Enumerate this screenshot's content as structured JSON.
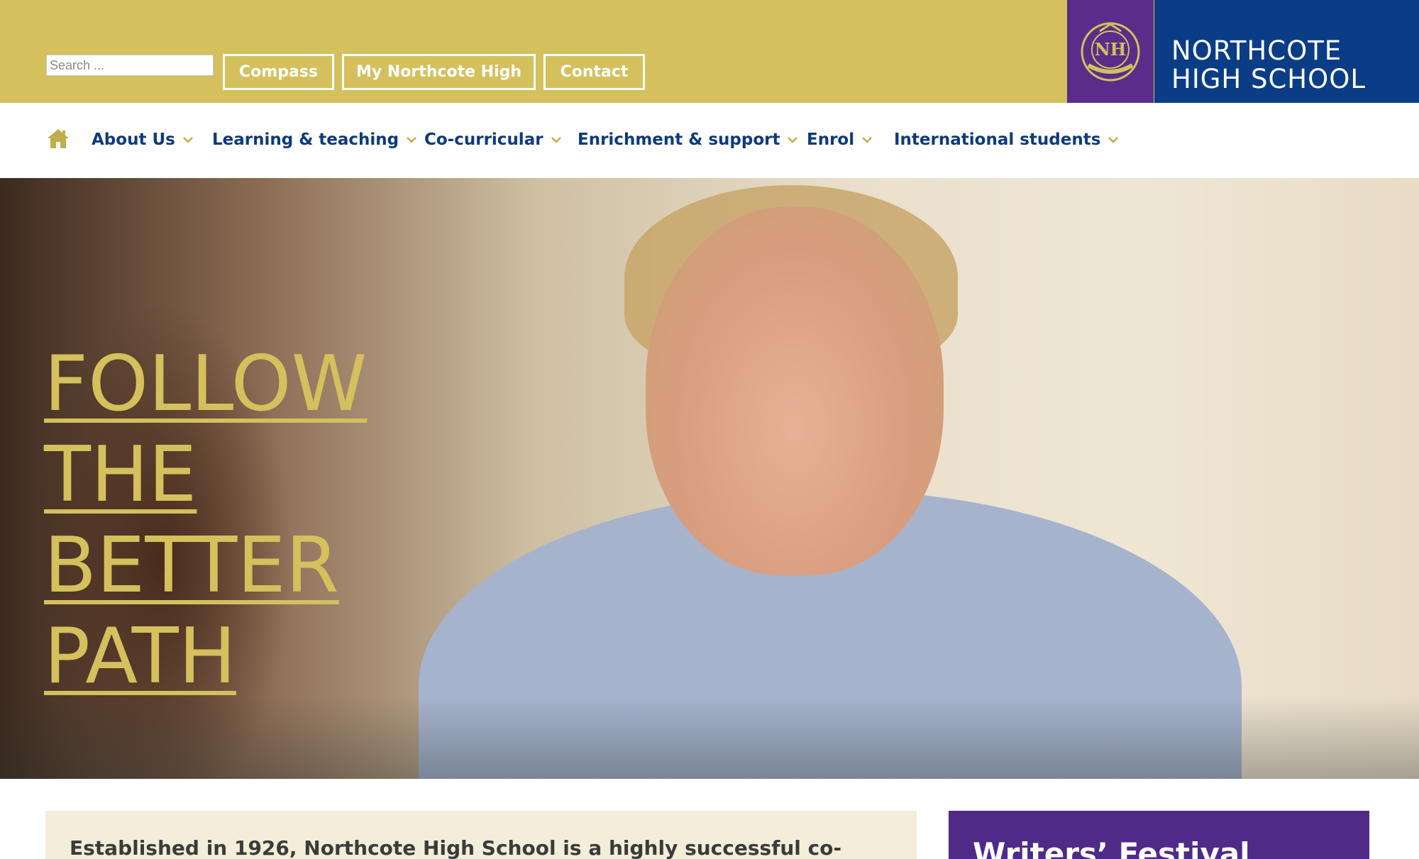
{
  "header": {
    "search": {
      "placeholder": "Search ...",
      "value": ""
    },
    "buttons": [
      "Compass",
      "My Northcote High",
      "Contact"
    ],
    "logo": {
      "line1": "NORTHCOTE",
      "line2": "HIGH SCHOOL",
      "crest_text": "NORTHCOTE"
    },
    "colors": {
      "gold": "#d4c05d",
      "purple": "#5a2d8a",
      "navy": "#0b3d86"
    }
  },
  "nav": {
    "home_icon": "home-icon",
    "items": [
      "About Us",
      "Learning & teaching",
      "Co-curricular",
      "Enrichment & support",
      "Enrol",
      "International students"
    ],
    "chevron_icon": "chevron-down-icon"
  },
  "hero": {
    "lines": [
      "FOLLOW",
      "THE",
      "BETTER",
      "PATH"
    ]
  },
  "content": {
    "intro_text": "Established in 1926, Northcote High School is a highly successful co-",
    "event_title": "Writers’ Festival"
  }
}
